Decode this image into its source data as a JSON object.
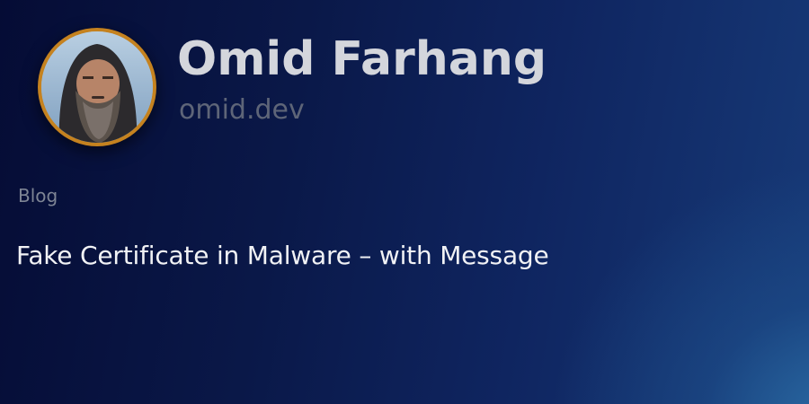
{
  "author": {
    "name": "Omid Farhang",
    "site": "omid.dev",
    "avatar_icon": "avatar-photo"
  },
  "post": {
    "category": "Blog",
    "title": "Fake Certificate in Malware – with Message"
  },
  "colors": {
    "background_dark": "#050c35",
    "background_light": "#2a6aa3",
    "avatar_ring": "#c5821f",
    "name_text": "#d4d6dc",
    "site_text": "#5e6578",
    "category_text": "#7d8494",
    "title_text": "#f1f2f5"
  }
}
